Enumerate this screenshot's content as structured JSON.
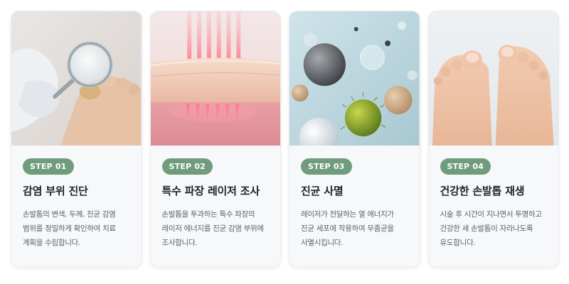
{
  "steps": [
    {
      "badge": "STEP 01",
      "title": "감염 부위 진단",
      "desc": "손발톱의 변색, 두께, 진균 감염 범위를 정밀하게 확인하여 치료 계획을 수립합니다."
    },
    {
      "badge": "STEP 02",
      "title": "특수 파장 레이저 조사",
      "desc": "손발톱을 투과하는 특수 파장의 레이저 에너지를 진균 감염 부위에 조사합니다."
    },
    {
      "badge": "STEP 03",
      "title": "진균 사멸",
      "desc": "레이저가 전달하는 열 에너지가 진균 세포에 작용하여 무좀균을 사멸시킵니다."
    },
    {
      "badge": "STEP 04",
      "title": "건강한 손발톱 재생",
      "desc": "시술 후 시간이 지나면서 투명하고 건강한 새 손발톱이 자라나도록 유도합니다."
    }
  ],
  "colors": {
    "badge": "#6f9c7c",
    "title": "#1f2328",
    "desc": "#5c6168",
    "card": "#f7f8fa"
  }
}
